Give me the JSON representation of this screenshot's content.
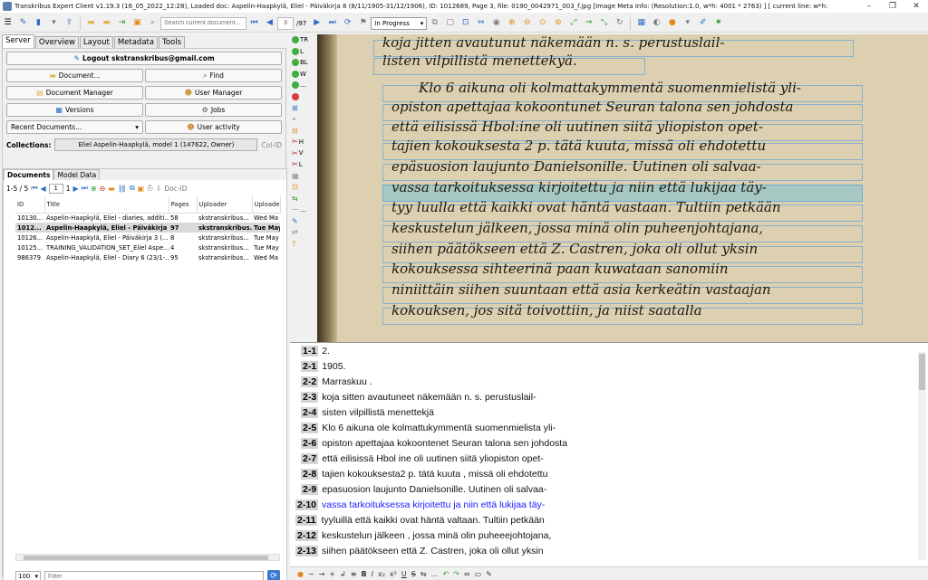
{
  "window": {
    "title": "Transkribus Expert Client v1.19.3 (16_05_2022_12:28), Loaded doc: Aspelin-Haapkylä, Eliel - Päiväkirja 8 (8/11/1905-31/12/1906), ID: 1012689, Page 3, file: 0190_0042971_003_f.jpg [Image Meta Info: (Resolution:1.0, w*h: 4001 * 2763) ] [ current line: w*h:"
  },
  "toolbar": {
    "search_placeholder": "Search current document...",
    "page_current": "3",
    "page_total": "/97",
    "status": "In Progress"
  },
  "left": {
    "tabs": [
      "Server",
      "Overview",
      "Layout",
      "Metadata",
      "Tools"
    ],
    "logout": "Logout skstranskribus@gmail.com",
    "buttons": {
      "document": "Document...",
      "find": "Find",
      "document_manager": "Document Manager",
      "user_manager": "User Manager",
      "versions": "Versions",
      "jobs": "Jobs",
      "recent_documents": "Recent Documents...",
      "user_activity": "User activity"
    },
    "collections_label": "Collections:",
    "collection": "Eliel Aspelin-Haapkylä, model 1 (147622, Owner)",
    "col_id": "Col-ID",
    "doc_tabs": [
      "Documents",
      "Model Data"
    ],
    "range": "1-5 / 5",
    "page_from": "1",
    "page_to": "1",
    "doc_id_label": "Doc-ID",
    "columns": [
      "ID",
      "Title",
      "Pages",
      "Uploader",
      "Uploade"
    ],
    "rows": [
      {
        "id": "10130...",
        "title": "Aspelin-Haapkylä, Eliel - diaries, additi...",
        "pages": "58",
        "uploader": "skstranskribus...",
        "date": "Wed Ma"
      },
      {
        "id": "1012...",
        "title": "Aspelin-Haapkylä, Eliel - Päiväkirja 8 ...",
        "pages": "97",
        "uploader": "skstranskribus...",
        "date": "Tue May"
      },
      {
        "id": "10126...",
        "title": "Aspelin-Haapkylä, Eliel - Päiväkirja 3 (...",
        "pages": "8",
        "uploader": "skstranskribus...",
        "date": "Tue May"
      },
      {
        "id": "10125...",
        "title": "TRAINING_VALIDATION_SET_Eliel Aspe...",
        "pages": "4",
        "uploader": "skstranskribus...",
        "date": "Tue May"
      },
      {
        "id": "986379",
        "title": "Aspelin-Haapkylä, Eliel - Diary 6 (23/1-...",
        "pages": "95",
        "uploader": "skstranskribus...",
        "date": "Wed Ma"
      }
    ],
    "page_size": "100",
    "filter_placeholder": "Filter"
  },
  "sidebar": {
    "items": [
      {
        "label": "TR",
        "kind": "plus"
      },
      {
        "label": "L",
        "kind": "plus"
      },
      {
        "label": "BL",
        "kind": "plus"
      },
      {
        "label": "W",
        "kind": "plus"
      },
      {
        "label": "...",
        "kind": "plus"
      },
      {
        "label": "",
        "kind": "minus"
      },
      {
        "label": "",
        "kind": "glyph"
      },
      {
        "label": "",
        "kind": "glyph"
      },
      {
        "label": "",
        "kind": "glyph"
      },
      {
        "label": "H",
        "kind": "scissors"
      },
      {
        "label": "V",
        "kind": "scissors"
      },
      {
        "label": "L",
        "kind": "scissors"
      },
      {
        "label": "",
        "kind": "glyph"
      },
      {
        "label": "",
        "kind": "glyph"
      },
      {
        "label": "",
        "kind": "glyph"
      },
      {
        "label": "...",
        "kind": "glyph"
      },
      {
        "label": "",
        "kind": "glyph"
      },
      {
        "label": "",
        "kind": "glyph"
      },
      {
        "label": "",
        "kind": "glyph"
      }
    ]
  },
  "handwriting": [
    "koja jitten avautunut näkemään n. s. perustuslail-",
    "listen vilpillistä menettekyä.",
    "Klo 6 aikuna oli kolmattakymmentä suomenmielistä yli-",
    "opiston apettajaa kokoontunet Seuran talona sen johdosta",
    "että eilisissä Hbol:ine oli uutinen siitä yliopiston opet-",
    "tajien kokouksesta 2 p. tätä kuuta, missä oli ehdotettu",
    "epäsuosion laujunto Danielsonille. Uutinen oli salvaa-",
    "vassa tarkoituksessa kirjoitettu ja niin että lukijaa täy-",
    "tyy luulla että kaikki ovat häntä vastaan. Tultiin petkään",
    "keskustelun jälkeen, jossa minä olin puheenjohtajana,",
    "siihen päätökseen että Z. Castren, joka oli ollut yksin",
    "kokouksessa sihteerinä paan kuwataan sanomiin",
    "niniittäin siihen suuntaan että asia kerkeätin vastaajan",
    "kokouksen, jos sitä toivottiin, ja niist saatalla"
  ],
  "editor": {
    "lines": [
      {
        "num": "1-1",
        "text": "2."
      },
      {
        "num": "2-1",
        "text": "1905."
      },
      {
        "num": "2-2",
        "text": "Marraskuu ."
      },
      {
        "num": "2-3",
        "text": "koja sitten avautuneet näkemään n. s. perustuslail-"
      },
      {
        "num": "2-4",
        "text": "sisten vilpillistä menettekjä"
      },
      {
        "num": "2-5",
        "text": "Klo 6 aikuna ole kolmattukymmentä suomenmielista yli-"
      },
      {
        "num": "2-6",
        "text": "opiston apettajaa kokoontenet Seuran talona sen johdosta"
      },
      {
        "num": "2-7",
        "text": "että eilisissä Hbol ine oli uutinen siitä yliopiston opet-"
      },
      {
        "num": "2-8",
        "text": "tajien kokouksesta2 p. tätä kuuta , missä oli ehdotettu"
      },
      {
        "num": "2-9",
        "text": "epasuosion laujunto Danielsonille. Uutinen oli salvaa-"
      },
      {
        "num": "2-10",
        "text": "vassa tarkoituksessa kirjoitettu ja niin että lukijaa täy-"
      },
      {
        "num": "2-11",
        "text": "tyyluillä että kaikki ovat häntä valtaan. Tultiin petkään"
      },
      {
        "num": "2-12",
        "text": "keskustelun jälkeen , jossa minä olin puheeejohtojana,"
      },
      {
        "num": "2-13",
        "text": "siihen päätökseen että Z. Castren, joka oli ollut yksin"
      }
    ]
  }
}
